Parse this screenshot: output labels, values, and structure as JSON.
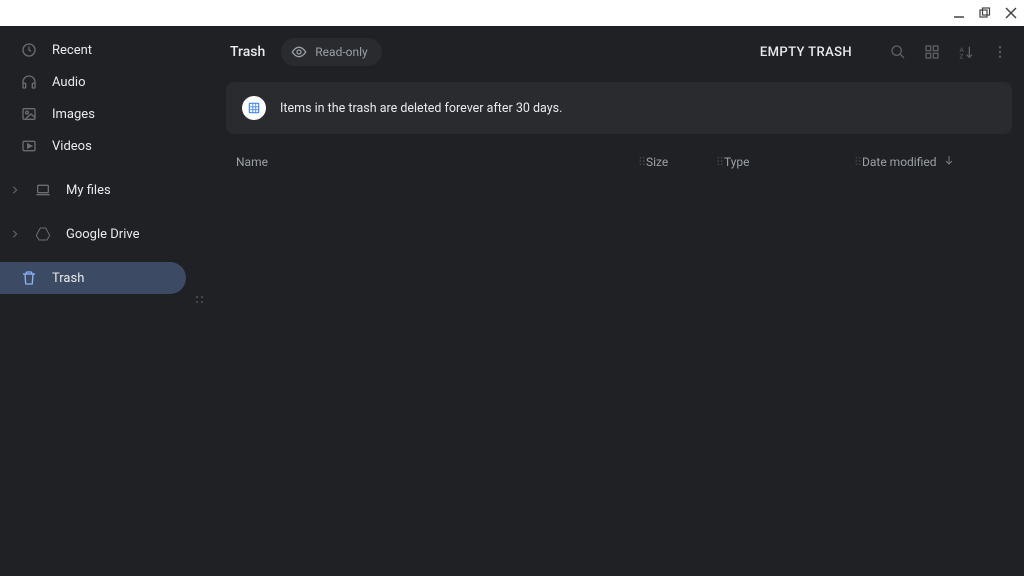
{
  "sidebar": {
    "items": [
      {
        "label": "Recent"
      },
      {
        "label": "Audio"
      },
      {
        "label": "Images"
      },
      {
        "label": "Videos"
      }
    ],
    "sections": [
      {
        "label": "My files"
      },
      {
        "label": "Google Drive"
      }
    ],
    "trash_label": "Trash"
  },
  "header": {
    "title": "Trash",
    "readonly_label": "Read-only",
    "empty_trash_label": "EMPTY TRASH"
  },
  "banner": {
    "text": "Items in the trash are deleted forever after 30 days."
  },
  "columns": {
    "name": "Name",
    "size": "Size",
    "type": "Type",
    "date": "Date modified"
  }
}
